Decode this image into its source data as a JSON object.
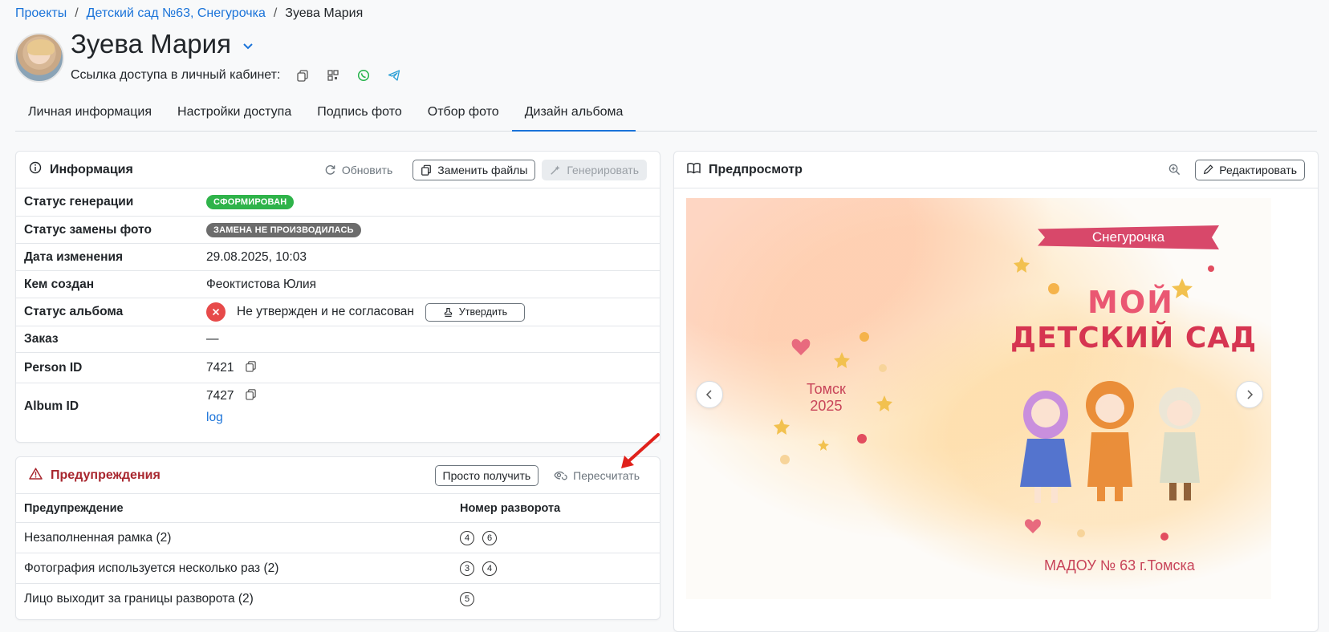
{
  "breadcrumb": {
    "items": [
      {
        "label": "Проекты"
      },
      {
        "label": "Детский сад №63, Снегурочка"
      }
    ],
    "current": "Зуева Мария",
    "sep": "/"
  },
  "header": {
    "name": "Зуева Мария",
    "access_label": "Ссылка доступа в личный кабинет:"
  },
  "tabs": [
    {
      "label": "Личная информация"
    },
    {
      "label": "Настройки доступа"
    },
    {
      "label": "Подпись фото"
    },
    {
      "label": "Отбор фото"
    },
    {
      "label": "Дизайн альбома",
      "active": true
    }
  ],
  "info": {
    "title": "Информация",
    "refresh": "Обновить",
    "replace": "Заменить файлы",
    "generate": "Генерировать",
    "rows": {
      "gen_status": {
        "label": "Статус генерации",
        "value": "СФОРМИРОВАН"
      },
      "replace_status": {
        "label": "Статус замены фото",
        "value": "ЗАМЕНА НЕ ПРОИЗВОДИЛАСЬ"
      },
      "date": {
        "label": "Дата изменения",
        "value": "29.08.2025, 10:03"
      },
      "created": {
        "label": "Кем создан",
        "value": "Феоктистова Юлия"
      },
      "album_status": {
        "label": "Статус альбома",
        "value": "Не утвержден и не согласован",
        "button": "Утвердить"
      },
      "order": {
        "label": "Заказ",
        "value": "—"
      },
      "person": {
        "label": "Person ID",
        "value": "7421"
      },
      "album": {
        "label": "Album ID",
        "value": "7427",
        "link": "log"
      }
    }
  },
  "warnings": {
    "title": "Предупреждения",
    "btn_get": "Просто получить",
    "btn_recount": "Пересчитать",
    "col1": "Предупреждение",
    "col2": "Номер разворота",
    "rows": [
      {
        "text": "Незаполненная рамка (2)",
        "nums": [
          "4",
          "6"
        ]
      },
      {
        "text": "Фотография используется несколько раз (2)",
        "nums": [
          "3",
          "4"
        ]
      },
      {
        "text": "Лицо выходит за границы разворота (2)",
        "nums": [
          "5"
        ]
      }
    ]
  },
  "preview": {
    "title": "Предпросмотр",
    "edit": "Редактировать",
    "ribbon": "Снегурочка",
    "line1": "МОЙ",
    "line2": "ДЕТСКИЙ САД",
    "city": "Томск",
    "year": "2025",
    "school": "МАДОУ № 63 г.Томска"
  },
  "colors": {
    "accent": "#1a73d9",
    "success": "#2fb34a",
    "danger": "#e74a4a",
    "warn_title": "#a8262e"
  }
}
